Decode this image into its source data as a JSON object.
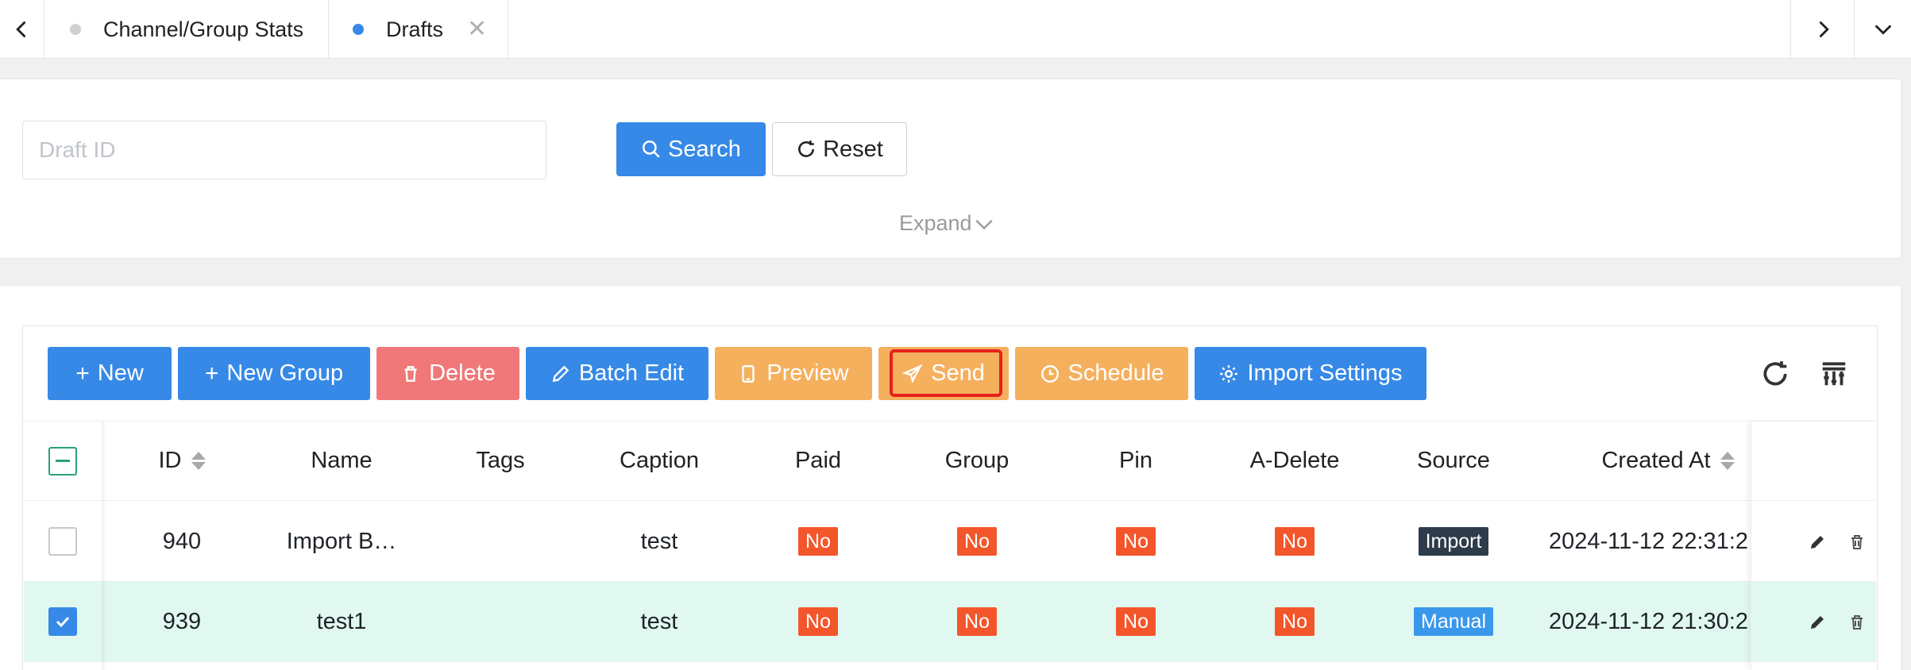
{
  "tabs": [
    {
      "label": "Channel/Group Stats"
    },
    {
      "label": "Drafts",
      "close": "✕"
    }
  ],
  "search": {
    "placeholder": "Draft ID",
    "value": "",
    "search_label": "Search",
    "reset_label": "Reset",
    "expand_label": "Expand"
  },
  "toolbar": {
    "new_label": "New",
    "new_group_label": "New Group",
    "delete_label": "Delete",
    "batch_edit_label": "Batch Edit",
    "preview_label": "Preview",
    "send_label": "Send",
    "schedule_label": "Schedule",
    "import_settings_label": "Import Settings"
  },
  "table": {
    "columns": [
      "ID",
      "Name",
      "Tags",
      "Caption",
      "Paid",
      "Group",
      "Pin",
      "A-Delete",
      "Source",
      "Created At"
    ],
    "rows": [
      {
        "id": "940",
        "name": "Import B…",
        "tags": "",
        "caption": "test",
        "paid": "No",
        "group": "No",
        "pin": "No",
        "a_delete": "No",
        "source": "Import",
        "created_at": "2024-11-12 22:31:2",
        "checked": false
      },
      {
        "id": "939",
        "name": "test1",
        "tags": "",
        "caption": "test",
        "paid": "No",
        "group": "No",
        "pin": "No",
        "a_delete": "No",
        "source": "Manual",
        "created_at": "2024-11-12 21:30:2",
        "checked": true
      }
    ]
  },
  "colors": {
    "primary": "#3689e6",
    "danger": "#f07878",
    "warning": "#f5b05e",
    "tag_no": "#f4562b",
    "tag_import": "#2d3b4a",
    "tag_manual": "#3a98ec",
    "selected_row": "#e1f8f0",
    "highlight": "#e8211b"
  },
  "icons": {
    "tab_prev": "chevron-left-icon",
    "tab_next": "chevron-right-icon",
    "tab_more": "chevron-down-icon",
    "search": "search-icon",
    "reset": "refresh-icon",
    "refresh": "refresh-icon",
    "columns": "columns-icon",
    "edit": "pencil-icon",
    "delete": "trash-icon"
  }
}
